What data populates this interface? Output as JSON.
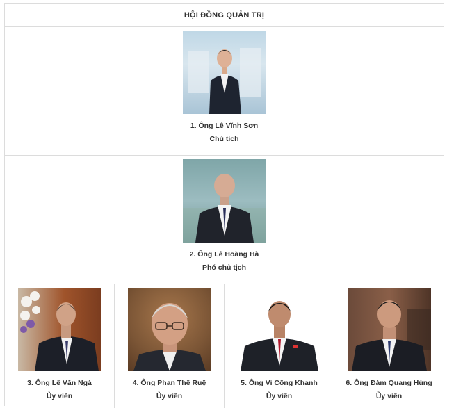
{
  "header": {
    "title": "HỘI ĐỒNG QUẢN TRỊ"
  },
  "members": [
    {
      "name": "1. Ông Lê Vĩnh Sơn",
      "role": "Chủ tịch",
      "photo_icon": "portrait-photo"
    },
    {
      "name": "2. Ông Lê Hoàng Hà",
      "role": "Phó chủ tịch",
      "photo_icon": "portrait-photo"
    },
    {
      "name": "3. Ông Lê Văn Ngà",
      "role": "Ủy viên",
      "photo_icon": "portrait-photo"
    },
    {
      "name": "4. Ông Phan Thế Ruệ",
      "role": "Ủy viên",
      "photo_icon": "portrait-photo"
    },
    {
      "name": "5. Ông Vi Công Khanh",
      "role": "Ủy viên",
      "photo_icon": "portrait-photo"
    },
    {
      "name": "6. Ông Đàm Quang Hùng",
      "role": "Ủy viên",
      "photo_icon": "portrait-photo"
    }
  ]
}
